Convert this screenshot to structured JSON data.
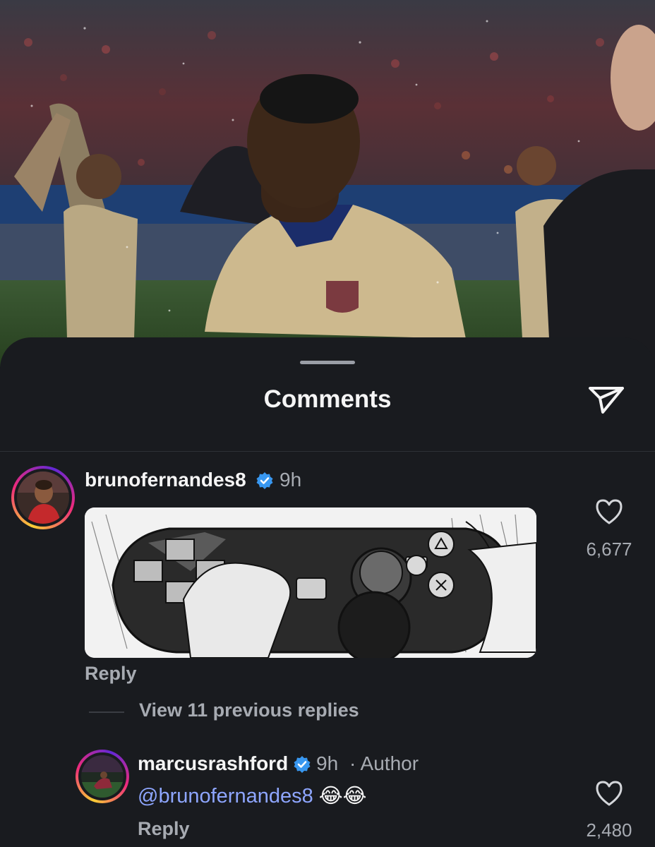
{
  "header": {
    "title": "Comments"
  },
  "comments": [
    {
      "username": "brunofernandes8",
      "time": "9h",
      "verified": true,
      "reply_label": "Reply",
      "likes": "6,677",
      "view_replies_label": "View 11 previous replies"
    },
    {
      "username": "marcusrashford",
      "time": "9h",
      "author_tag": "· Author",
      "verified": true,
      "mention": "@brunofernandes8",
      "emojis": "😂😂",
      "reply_label": "Reply",
      "likes": "2,480"
    }
  ],
  "icons": {
    "share": "paper-plane-icon",
    "like": "heart-icon",
    "verified": "verified-badge-icon"
  },
  "colors": {
    "sheet_background": "#191b1f",
    "verified_blue": "#3897f0",
    "mention_blue": "#8ea6ff",
    "muted_text": "#a7abb2"
  }
}
